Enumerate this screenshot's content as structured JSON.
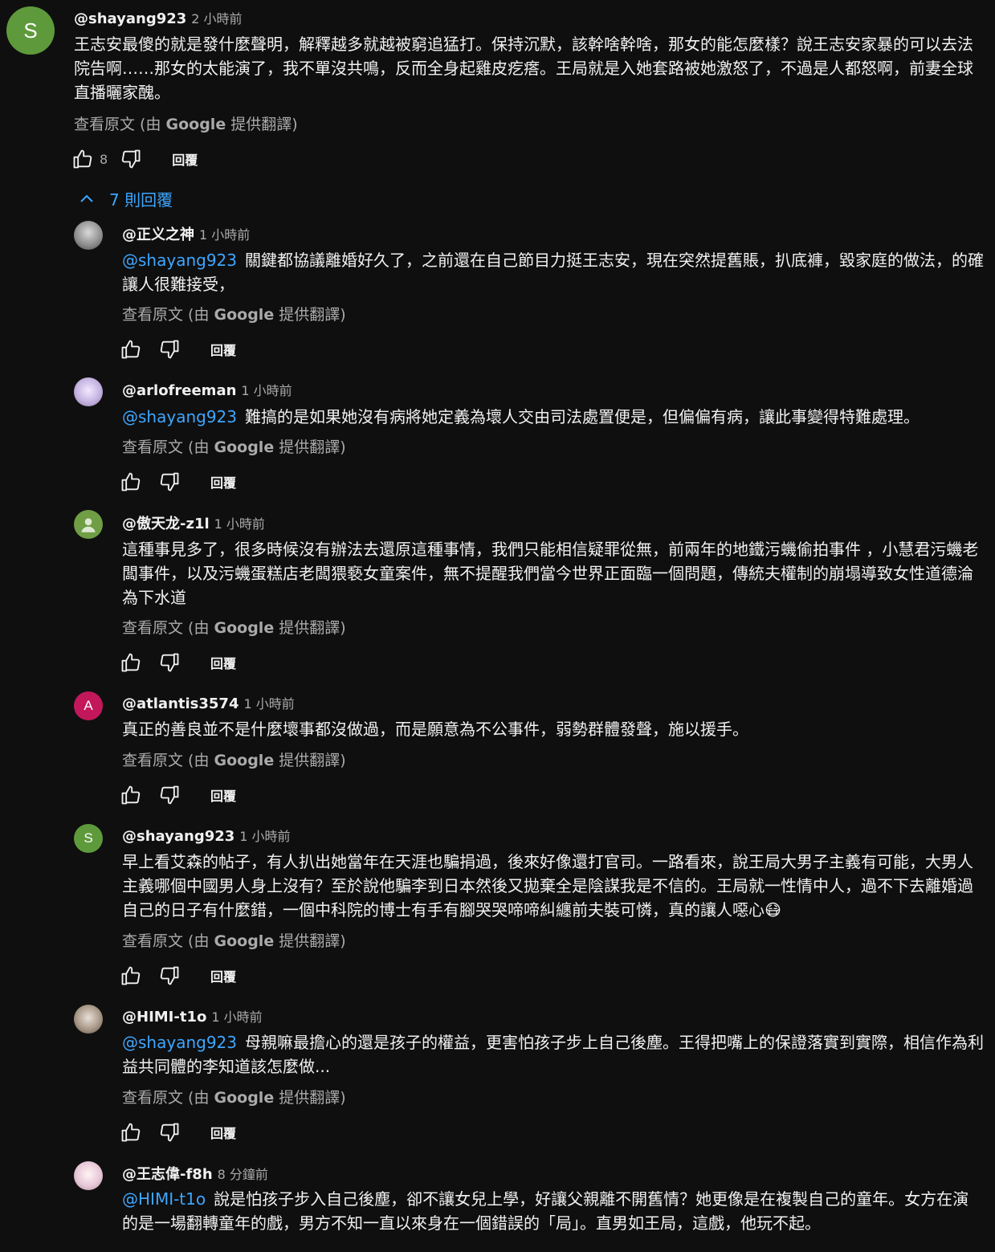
{
  "ui": {
    "translate_prefix": "查看原文 (由 ",
    "translate_brand": "Google",
    "translate_suffix": " 提供翻譯)",
    "reply_label": "回覆"
  },
  "top_comment": {
    "avatar_letter": "S",
    "avatar_color": "#5e9a3b",
    "author": "@shayang923",
    "time": "2 小時前",
    "text": "王志安最傻的就是發什麼聲明，解釋越多就越被窮追猛打。保持沉默，該幹啥幹啥，那女的能怎麼樣？說王志安家暴的可以去法院告啊……那女的太能演了，我不單沒共鳴，反而全身起雞皮疙瘩。王局就是入她套路被她激怒了，不過是人都怒啊，前妻全球直播曬家醜。",
    "likes": "8"
  },
  "replies_toggle": "7 則回覆",
  "replies": [
    {
      "author": "@正义之神",
      "time": "1 小時前",
      "mention": "@shayang923",
      "text": "關鍵都協議離婚好久了，之前還在自己節目力挺王志安，現在突然提舊賬，扒底褲，毀家庭的做法，的確讓人很難接受，"
    },
    {
      "author": "@arlofreeman",
      "time": "1 小時前",
      "mention": "@shayang923",
      "text": "難搞的是如果她沒有病將她定義為壞人交由司法處置便是，但偏偏有病，讓此事變得特難處理。"
    },
    {
      "author": "@傲天龙-z1l",
      "time": "1 小時前",
      "mention": "",
      "text": "這種事見多了，很多時候沒有辦法去還原這種事情，我們只能相信疑罪從無，前兩年的地鐵污蟣偷拍事件 ，小慧君污蟣老闆事件，以及污蟣蛋糕店老闆猥褻女童案件，無不提醒我們當今世界正面臨一個問題，傳統夫權制的崩塌導致女性道德淪為下水道"
    },
    {
      "author": "@atlantis3574",
      "time": "1 小時前",
      "avatar_letter": "A",
      "avatar_color": "#c2185b",
      "mention": "",
      "text": "真正的善良並不是什麼壞事都沒做過，而是願意為不公事件，弱勢群體發聲，施以援手。"
    },
    {
      "author": "@shayang923",
      "time": "1 小時前",
      "avatar_letter": "S",
      "avatar_color": "#5e9a3b",
      "mention": "",
      "text": "早上看艾森的帖子，有人扒出她當年在天涯也騙捐過，後來好像還打官司。一路看來，說王局大男子主義有可能，大男人主義哪個中國男人身上沒有？至於說他騙李到日本然後又拋棄全是陰謀我是不信的。王局就一性情中人，過不下去離婚過自己的日子有什麼錯，一個中科院的博士有手有腳哭哭啼啼糾纏前夫裝可憐，真的讓人噁心😷"
    },
    {
      "author": "@HIMI-t1o",
      "time": "1 小時前",
      "mention": "@shayang923",
      "text": "母親嘛最擔心的還是孩子的權益，更害怕孩子步上自己後塵。王得把嘴上的保證落實到實際，相信作為利益共同體的李知道該怎麼做..."
    },
    {
      "author": "@王志偉-f8h",
      "time": "8 分鐘前",
      "mention": "@HIMI-t1o",
      "text": "說是怕孩子步入自己後塵，卻不讓女兒上學，好讓父親離不開舊情？她更像是在複製自己的童年。女方在演的是一場翻轉童年的戲，男方不知一直以來身在一個錯誤的「局」。直男如王局，這戲，他玩不起。"
    }
  ]
}
